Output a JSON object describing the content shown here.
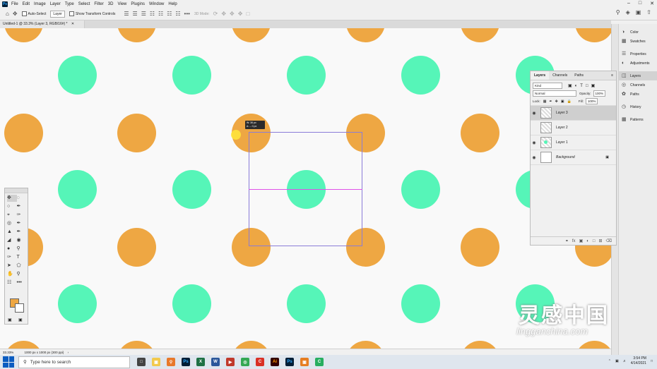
{
  "app": {
    "logo": "Ps"
  },
  "menubar": {
    "items": [
      "File",
      "Edit",
      "Image",
      "Layer",
      "Type",
      "Select",
      "Filter",
      "3D",
      "View",
      "Plugins",
      "Window",
      "Help"
    ]
  },
  "options": {
    "auto_select_label": "Auto-Select",
    "auto_select_target": "Layer",
    "transform_controls_label": "Show Transform Controls",
    "mode_3d_label": "3D Mode:"
  },
  "document": {
    "tab_title": "Untitled-1 @ 33.3% (Layer 3, RGB/16#) *"
  },
  "status": {
    "zoom": "33.33%",
    "doc_size": "1000 px x 1000 px (300 ppi)"
  },
  "tooltip": {
    "line1": "W: 36 px",
    "line2": "Δ: -- 0 px"
  },
  "layers_panel": {
    "tabs": [
      "Layers",
      "Channels",
      "Paths"
    ],
    "kind_filter": "Kind",
    "blend_mode": "Normal",
    "opacity_label": "Opacity:",
    "opacity_value": "100%",
    "lock_label": "Lock:",
    "fill_label": "Fill:",
    "fill_value": "100%",
    "layers": [
      {
        "name": "Layer 3",
        "visible": true,
        "selected": true
      },
      {
        "name": "Layer 2",
        "visible": false,
        "selected": false
      },
      {
        "name": "Layer 1",
        "visible": true,
        "selected": false
      },
      {
        "name": "Background",
        "visible": true,
        "selected": false
      }
    ]
  },
  "dock": {
    "items": [
      "Color",
      "Swatches",
      "Properties",
      "Adjustments",
      "Layers",
      "Channels",
      "Paths",
      "History",
      "Patterns"
    ]
  },
  "watermark": {
    "main": "灵感中国",
    "sub": "lingganchina.com"
  },
  "taskbar": {
    "search_placeholder": "Type here to search",
    "time": "3:54 PM",
    "date": "4/14/2021"
  },
  "colors": {
    "dot_orange": "#eea743",
    "dot_green": "#56f5b8",
    "foreground": "#eea743",
    "background": "#ffffff"
  }
}
